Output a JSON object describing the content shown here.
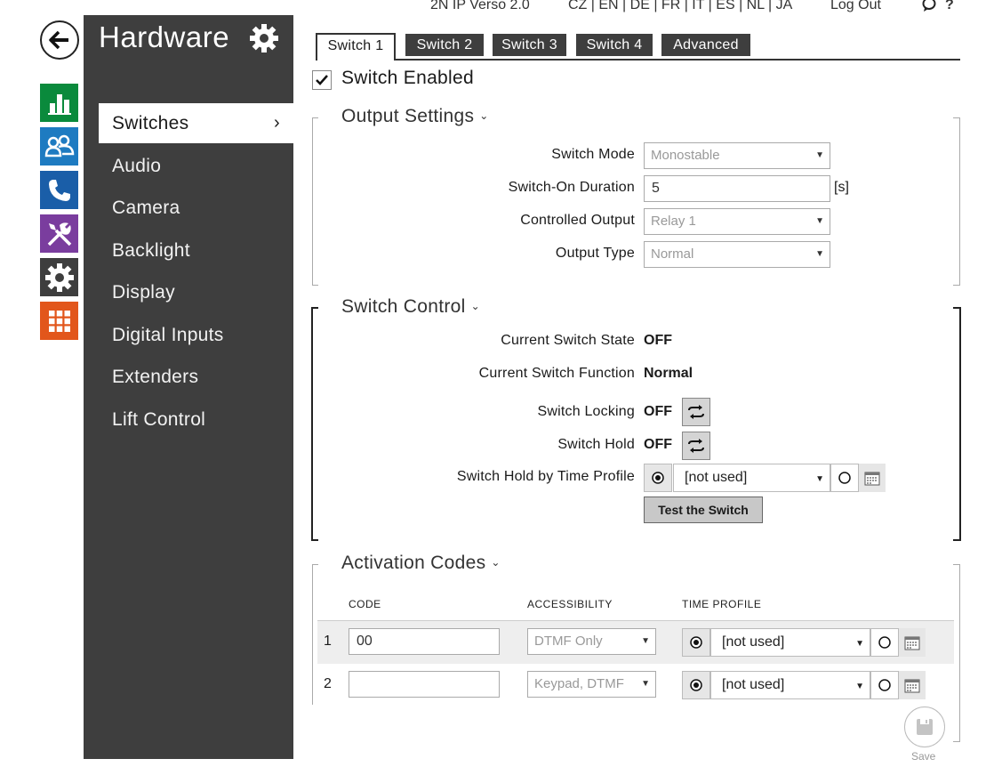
{
  "topbar": {
    "product": "2N IP Verso 2.0",
    "languages": "CZ | EN | DE | FR | IT | ES | NL | JA",
    "logout": "Log Out",
    "help": "?"
  },
  "rail": {
    "icons": [
      "back-arrow-icon",
      "status-chart-icon",
      "directory-users-icon",
      "phone-icon",
      "services-tools-icon",
      "hardware-gear-icon",
      "system-grid-icon"
    ],
    "colors": {
      "status": "#0a8a3c",
      "directory": "#1e7bc1",
      "phone": "#1a5ea8",
      "services": "#7a3d9e",
      "hardware": "#3e3e3e",
      "system": "#e2561b"
    }
  },
  "sidemenu": {
    "title": "Hardware",
    "items": [
      {
        "label": "Switches",
        "active": true,
        "chevron": "›"
      },
      {
        "label": "Audio"
      },
      {
        "label": "Camera"
      },
      {
        "label": "Backlight"
      },
      {
        "label": "Display"
      },
      {
        "label": "Digital Inputs"
      },
      {
        "label": "Extenders"
      },
      {
        "label": "Lift Control"
      }
    ]
  },
  "tabs": [
    "Switch 1",
    "Switch 2",
    "Switch 3",
    "Switch 4",
    "Advanced"
  ],
  "switch_enabled": {
    "label": "Switch Enabled",
    "checked": true
  },
  "output_settings": {
    "title": "Output Settings",
    "switch_mode_label": "Switch Mode",
    "switch_mode_value": "Monostable",
    "duration_label": "Switch-On Duration",
    "duration_value": "5",
    "duration_unit": "[s]",
    "controlled_output_label": "Controlled Output",
    "controlled_output_value": "Relay 1",
    "output_type_label": "Output Type",
    "output_type_value": "Normal"
  },
  "switch_control": {
    "title": "Switch Control",
    "state_label": "Current Switch State",
    "state_value": "OFF",
    "function_label": "Current Switch Function",
    "function_value": "Normal",
    "locking_label": "Switch Locking",
    "locking_value": "OFF",
    "hold_label": "Switch Hold",
    "hold_value": "OFF",
    "hold_profile_label": "Switch Hold by Time Profile",
    "hold_profile_value": "[not used]",
    "test_button": "Test the Switch"
  },
  "activation_codes": {
    "title": "Activation Codes",
    "col_code": "CODE",
    "col_access": "ACCESSIBILITY",
    "col_profile": "TIME PROFILE",
    "rows": [
      {
        "num": "1",
        "code": "00",
        "access": "DTMF Only",
        "profile": "[not used]"
      },
      {
        "num": "2",
        "code": "",
        "access": "Keypad, DTMF",
        "profile": "[not used]"
      }
    ]
  },
  "save": {
    "label": "Save"
  }
}
